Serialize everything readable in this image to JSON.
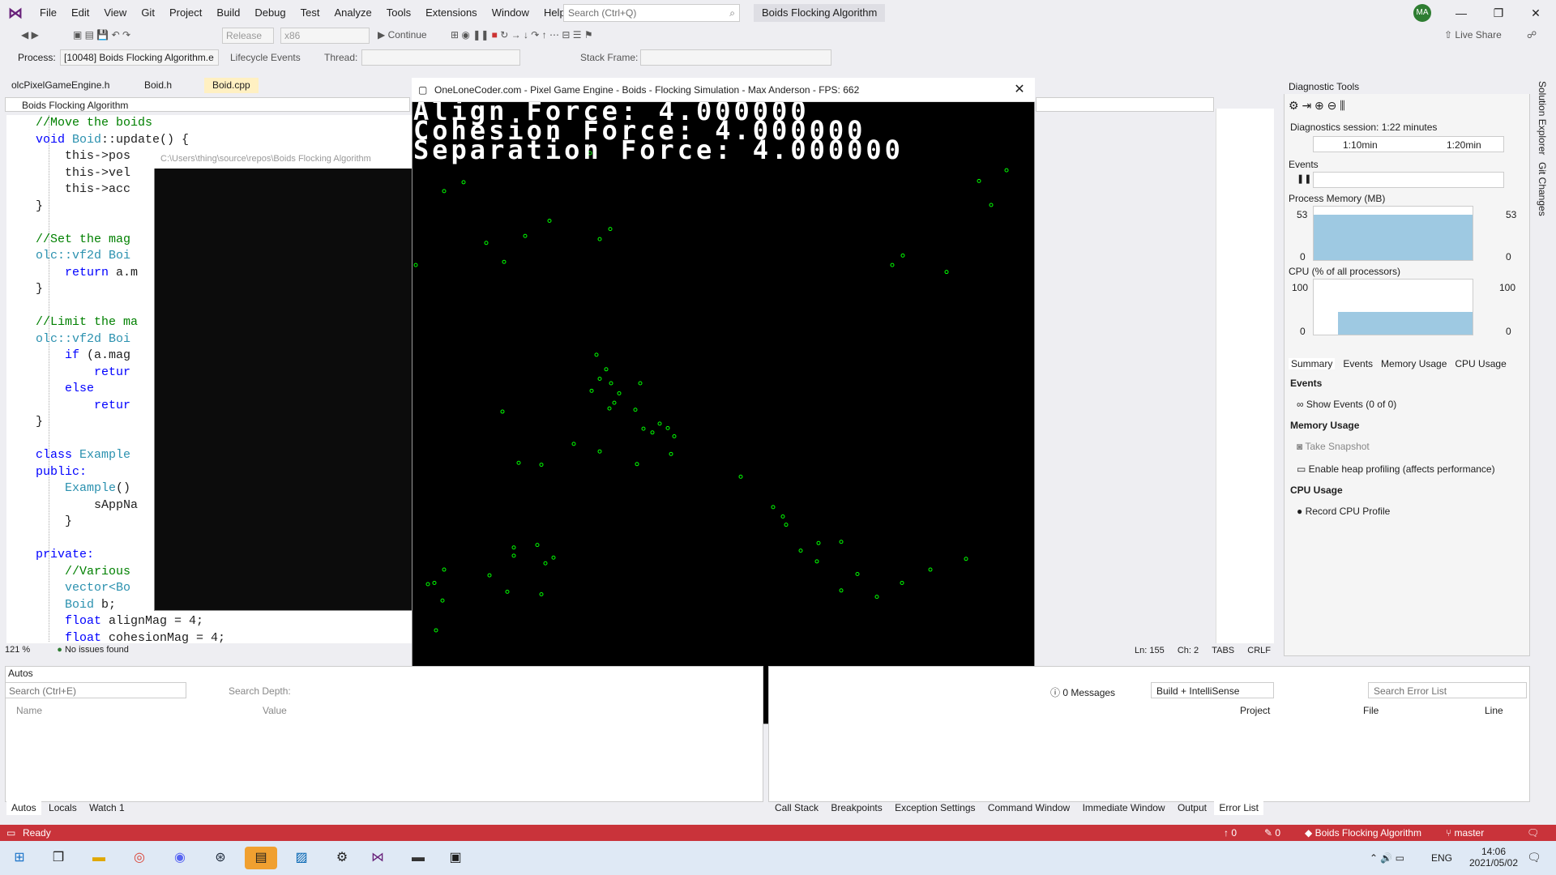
{
  "menu": [
    "File",
    "Edit",
    "View",
    "Git",
    "Project",
    "Build",
    "Debug",
    "Test",
    "Analyze",
    "Tools",
    "Extensions",
    "Window",
    "Help"
  ],
  "search_placeholder": "Search (Ctrl+Q)",
  "solution_title": "Boids Flocking Algorithm",
  "avatar": "MA",
  "live_share": "Live Share",
  "toolbar": {
    "config": "Release",
    "platform": "x86",
    "continue": "Continue",
    "process_label": "Process:",
    "process": "[10048] Boids Flocking Algorithm.e",
    "lifecycle": "Lifecycle Events",
    "thread": "Thread:",
    "stack": "Stack Frame:"
  },
  "tabs": [
    "olcPixelGameEngine.h",
    "Boid.h",
    "Boid.cpp"
  ],
  "nav_scope": "Boids Flocking Algorithm",
  "code": [
    [
      "cm",
      "    //Move the boids"
    ],
    [
      "kw",
      "    void ",
      "ty",
      "Boid",
      "",
      "::update() {"
    ],
    [
      "",
      "        this->pos"
    ],
    [
      "",
      "        this->vel"
    ],
    [
      "",
      "        this->acc"
    ],
    [
      "",
      "    }"
    ],
    [
      "",
      ""
    ],
    [
      "cm",
      "    //Set the mag"
    ],
    [
      "ty",
      "    olc::vf2d Boi"
    ],
    [
      "kw",
      "        return ",
      "",
      "a.m"
    ],
    [
      "",
      "    }"
    ],
    [
      "",
      ""
    ],
    [
      "cm",
      "    //Limit the ma"
    ],
    [
      "ty",
      "    olc::vf2d Boi"
    ],
    [
      "kw",
      "        if ",
      "",
      "(a.mag"
    ],
    [
      "kw",
      "            retur",
      "",
      " "
    ],
    [
      "kw",
      "        else",
      "",
      " "
    ],
    [
      "kw",
      "            retur",
      "",
      " "
    ],
    [
      "",
      "    }"
    ],
    [
      "",
      ""
    ],
    [
      "kw",
      "    class ",
      "ty",
      "Example"
    ],
    [
      "kw",
      "    public:"
    ],
    [
      "ty",
      "        Example",
      "",
      "()"
    ],
    [
      "",
      "            sAppNa"
    ],
    [
      "",
      "        }"
    ],
    [
      "",
      ""
    ],
    [
      "kw",
      "    private:"
    ],
    [
      "cm",
      "        //Various"
    ],
    [
      "ty",
      "        vector<Bo"
    ],
    [
      "ty",
      "        Boid ",
      "",
      "b;"
    ],
    [
      "kw",
      "        float ",
      "",
      "alignMag = 4;"
    ],
    [
      "kw",
      "        float ",
      "",
      "cohesionMag = 4;"
    ]
  ],
  "console_title": "C:\\Users\\thing\\source\\repos\\Boids Flocking Algorithm",
  "game": {
    "title": "OneLoneCoder.com - Pixel Game Engine - Boids - Flocking Simulation - Max Anderson - FPS: 662",
    "align": "Align Force: 4.000000",
    "cohesion": "Cohesion Force: 4.000000",
    "separation": "Separation Force: 4.000000",
    "boid_color": "#00ff00"
  },
  "editor_status": {
    "zoom": "121 %",
    "issues": "No issues found",
    "ln": "Ln: 155",
    "ch": "Ch: 2",
    "tabs": "TABS",
    "crlf": "CRLF"
  },
  "diag": {
    "title": "Diagnostic Tools",
    "session": "Diagnostics session: 1:22 minutes",
    "t1": "1:10min",
    "t2": "1:20min",
    "events": "Events",
    "memory": "Process Memory (MB)",
    "mem_max": "53",
    "mem_min": "0",
    "cpu": "CPU (% of all processors)",
    "cpu_max": "100",
    "cpu_min": "0",
    "tabs": [
      "Summary",
      "Events",
      "Memory Usage",
      "CPU Usage"
    ],
    "sec_events": "Events",
    "show_events": "Show Events (0 of 0)",
    "sec_mem": "Memory Usage",
    "snapshot": "Take Snapshot",
    "heap": "Enable heap profiling (affects performance)",
    "sec_cpu": "CPU Usage",
    "record": "Record CPU Profile"
  },
  "autos": {
    "title": "Autos",
    "search": "Search (Ctrl+E)",
    "depth": "Search Depth:",
    "col_name": "Name",
    "col_value": "Value"
  },
  "errors": {
    "messages": "0 Messages",
    "build": "Build + IntelliSense",
    "search": "Search Error List",
    "col_project": "Project",
    "col_file": "File",
    "col_line": "Line"
  },
  "bottom_tabs_left": [
    "Autos",
    "Locals",
    "Watch 1"
  ],
  "bottom_tabs_right": [
    "Call Stack",
    "Breakpoints",
    "Exception Settings",
    "Command Window",
    "Immediate Window",
    "Output",
    "Error List"
  ],
  "status": {
    "ready": "Ready",
    "up": "0",
    "pencil": "0",
    "repo": "Boids Flocking Algorithm",
    "branch": "master"
  },
  "tray": {
    "lang": "ENG",
    "time": "14:06",
    "date": "2021/05/02"
  },
  "side_tabs": [
    "Solution Explorer",
    "Git Changes"
  ]
}
